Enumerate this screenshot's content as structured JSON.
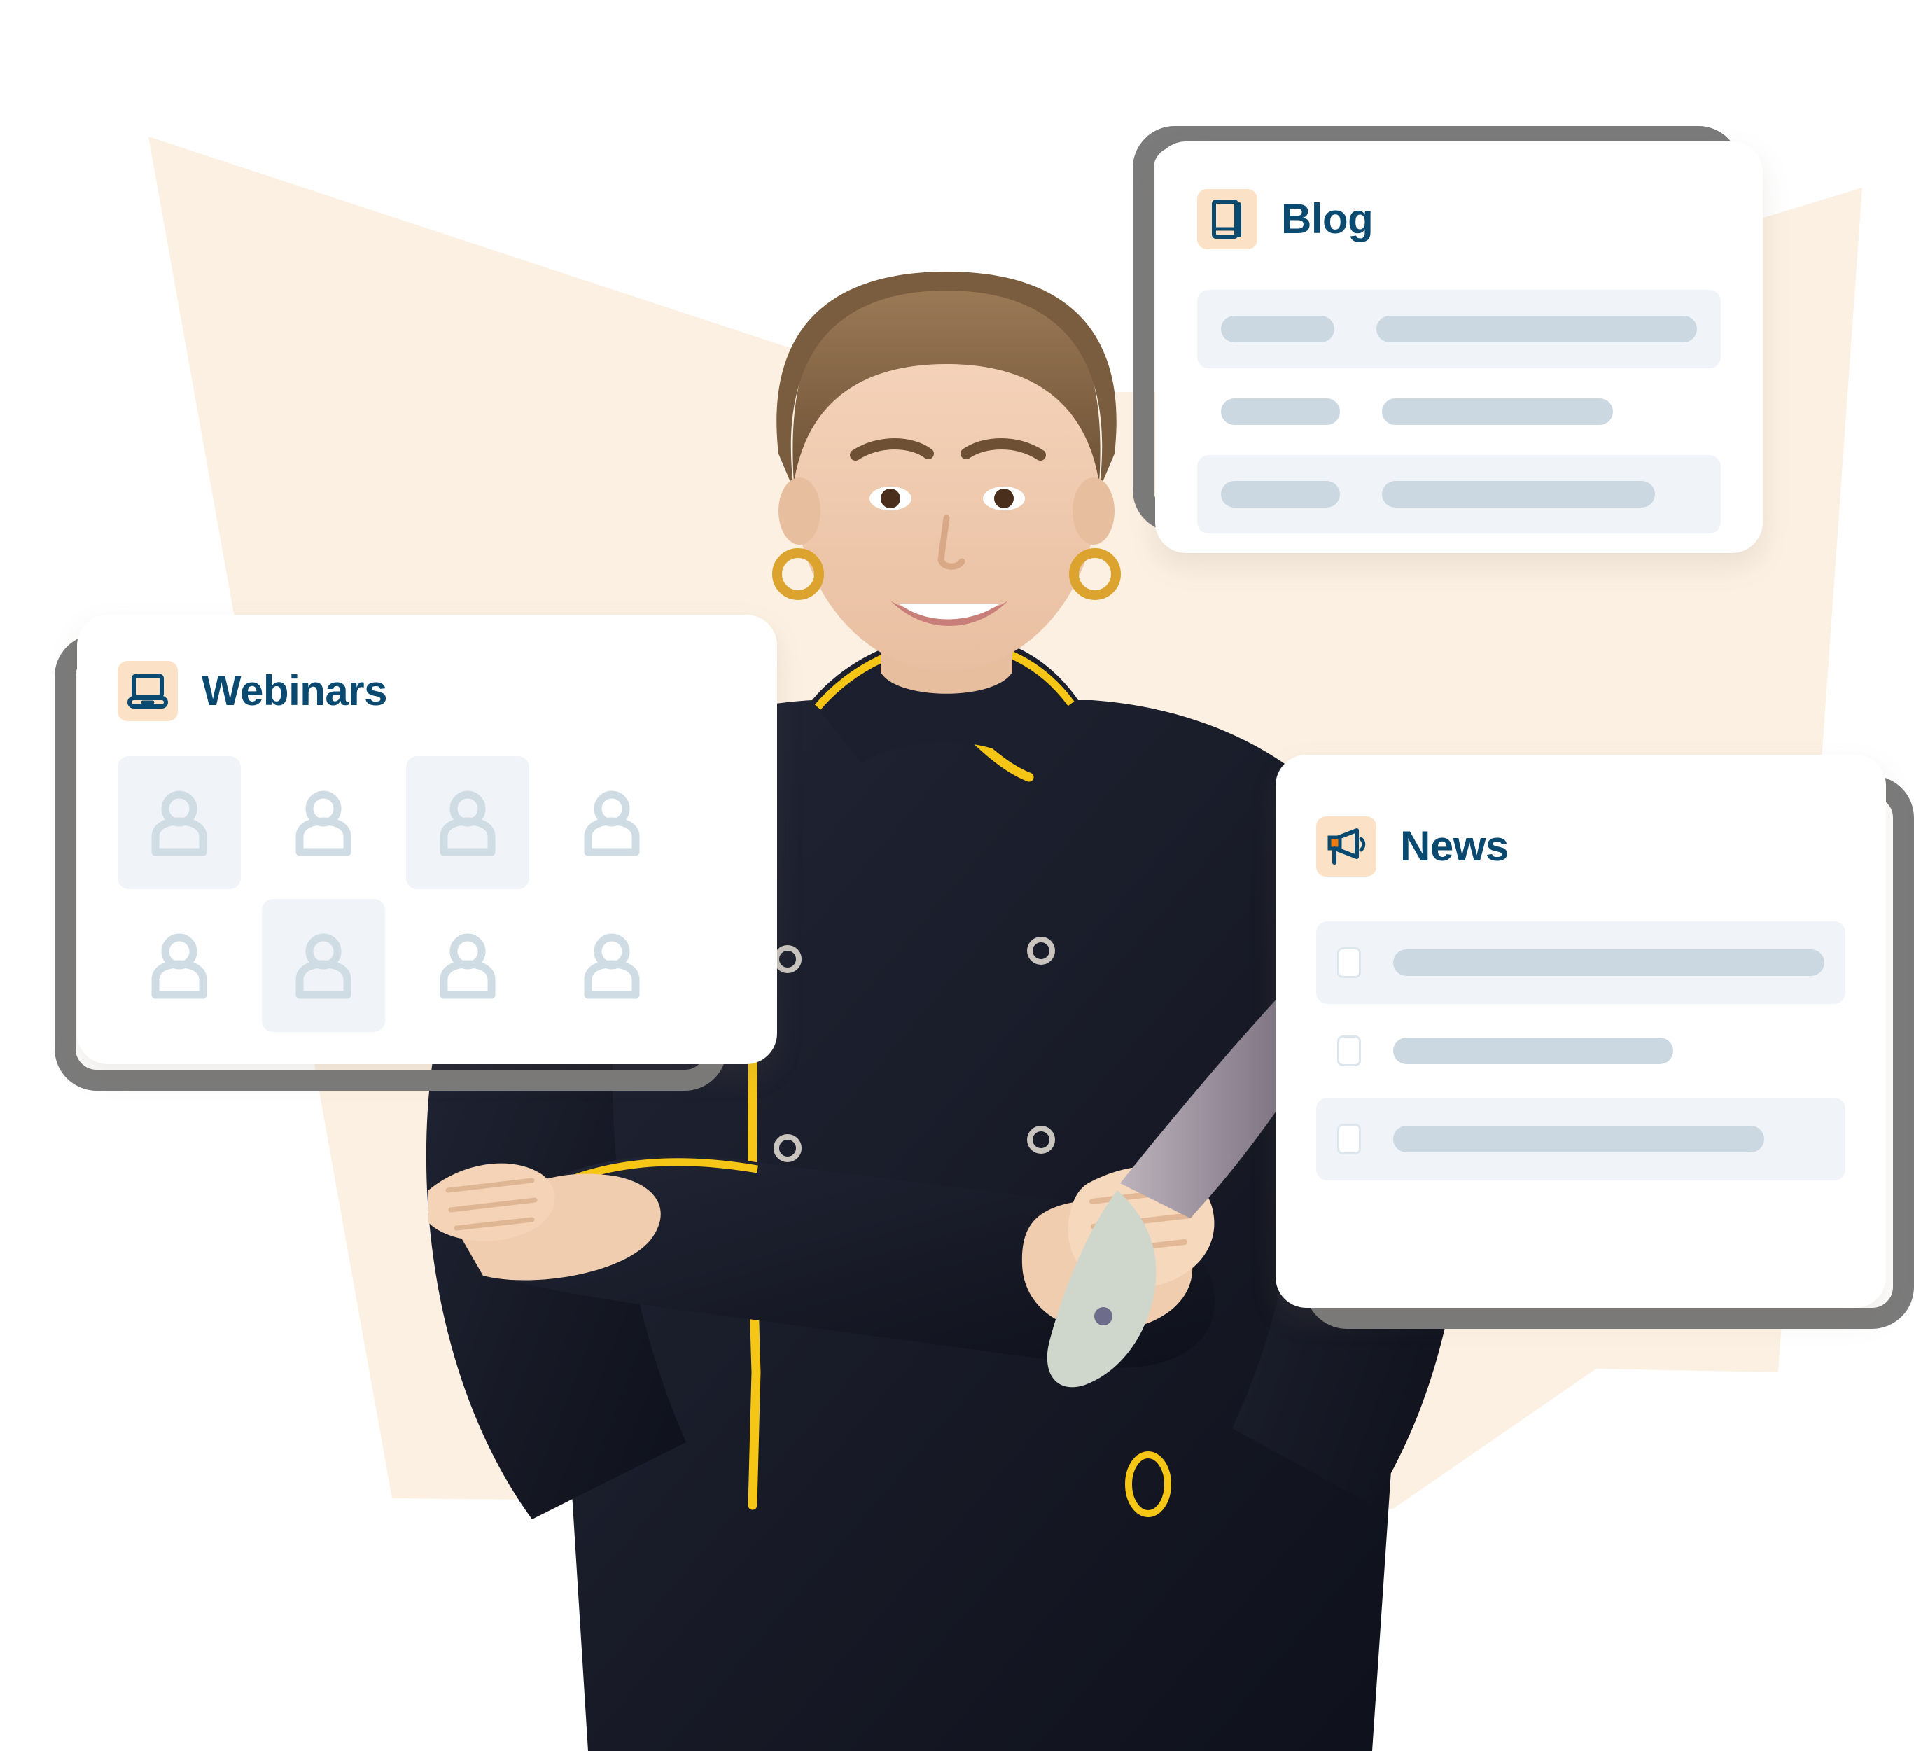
{
  "palette": {
    "page_background": "#FFFFFF",
    "wedge_beige": "#FBF0E2",
    "card_frame_gray": "#7B7B7B",
    "card_white": "#FFFFFF",
    "heading_navy": "#0B4A70",
    "icon_badge_peach": "#FBE2C6",
    "row_stripe": "#F0F4F8",
    "pill_gray_blue": "#CBD8E1",
    "avatar_gray_blue": "#CFDCE4",
    "megaphone_orange": "#ED7D10",
    "chef_jacket_black": "#171A26",
    "chef_piping_yellow": "#F5C616"
  },
  "cards": {
    "blog": {
      "title": "Blog",
      "icon": "book-icon",
      "rows": [
        {
          "striped": true,
          "tag_width": 170,
          "line_width": 480
        },
        {
          "striped": false,
          "tag_width": 170,
          "line_width": 330
        },
        {
          "striped": true,
          "tag_width": 170,
          "line_width": 390
        }
      ]
    },
    "webinars": {
      "title": "Webinars",
      "icon": "laptop-icon",
      "avatar_icon": "user-avatar-icon",
      "grid_columns": 4,
      "grid_rows": 2,
      "tinted_cells": [
        0,
        2,
        5
      ]
    },
    "news": {
      "title": "News",
      "icon": "megaphone-icon",
      "rows": [
        {
          "striped": true,
          "checkbox": true,
          "line_width": 620
        },
        {
          "striped": false,
          "checkbox": true,
          "line_width": 400
        },
        {
          "striped": true,
          "checkbox": true,
          "line_width": 530
        }
      ]
    }
  },
  "photo": {
    "alt": "smiling-female-chef-holding-knife"
  }
}
